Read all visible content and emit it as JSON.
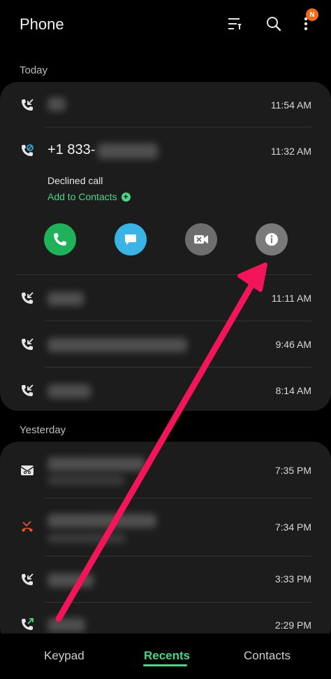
{
  "header": {
    "title": "Phone",
    "filter_icon": "filter-sort-icon",
    "search_icon": "search-icon",
    "more_icon": "more-vert-icon",
    "badge": "N"
  },
  "sections": {
    "today_label": "Today",
    "yesterday_label": "Yesterday"
  },
  "today": {
    "calls": [
      {
        "time": "11:54 AM",
        "icon": "incoming-call-icon"
      },
      {
        "time": "11:32 AM",
        "icon": "declined-call-icon"
      },
      {
        "time": "11:11 AM",
        "icon": "incoming-call-icon"
      },
      {
        "time": "9:46 AM",
        "icon": "incoming-call-icon"
      },
      {
        "time": "8:14 AM",
        "icon": "incoming-call-icon"
      }
    ],
    "expanded": {
      "number": "+1 833-",
      "status": "Declined call",
      "add_contacts": "Add to Contacts",
      "actions": [
        {
          "name": "call",
          "color": "#1fb25a"
        },
        {
          "name": "message",
          "color": "#39b4e4"
        },
        {
          "name": "video",
          "color": "#6e6e6e"
        },
        {
          "name": "info",
          "color": "#7a7a7a"
        }
      ]
    }
  },
  "yesterday": {
    "calls": [
      {
        "time": "7:35 PM",
        "icon": "voicemail-icon"
      },
      {
        "time": "7:34 PM",
        "icon": "missed-call-icon"
      },
      {
        "time": "3:33 PM",
        "icon": "incoming-call-icon"
      },
      {
        "time": "2:29 PM",
        "icon": "outgoing-call-icon"
      }
    ]
  },
  "nav": {
    "keypad": "Keypad",
    "recents": "Recents",
    "contacts": "Contacts",
    "active": "Recents"
  },
  "colors": {
    "accent_green": "#4cd787",
    "annotation_arrow": "#f2155a",
    "missed_red": "#e8542a",
    "badge_orange": "#f26b1d"
  }
}
